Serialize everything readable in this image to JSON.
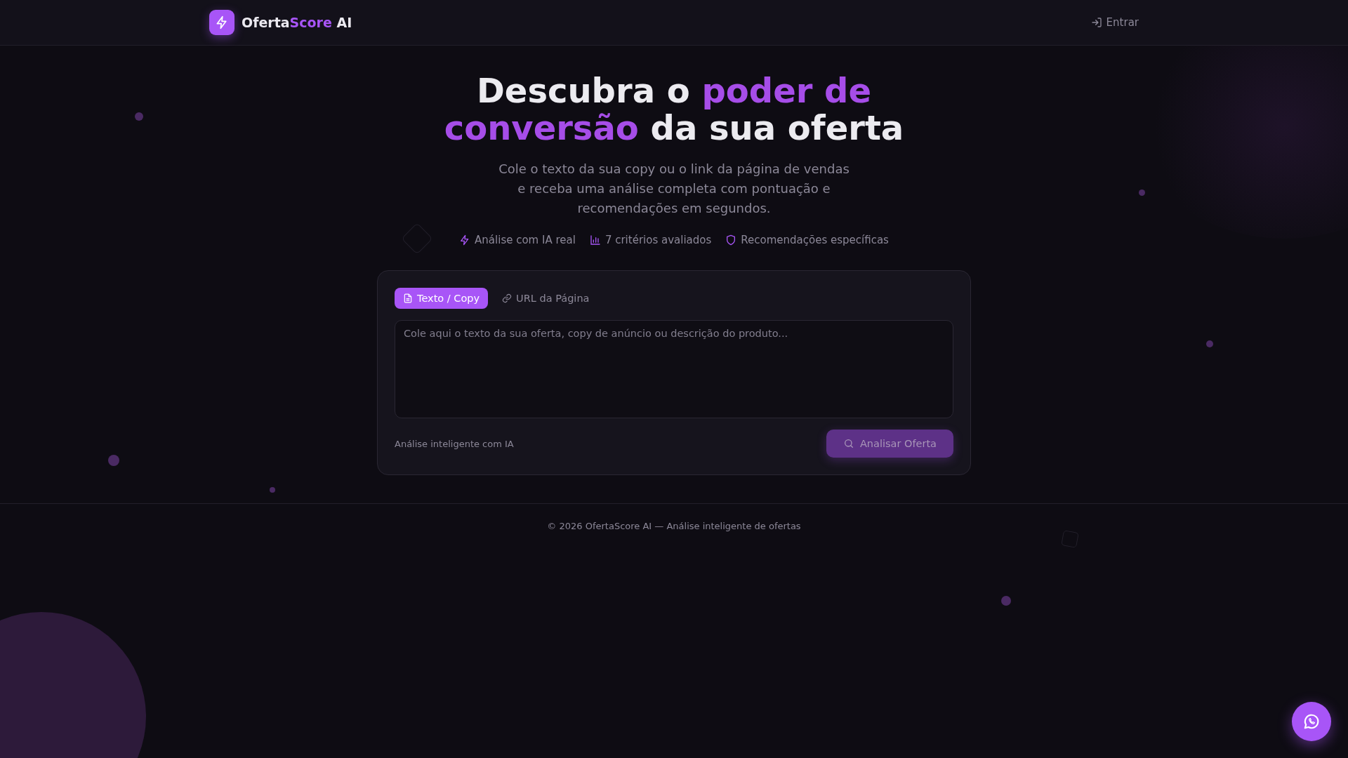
{
  "header": {
    "brand": [
      {
        "text": "Oferta",
        "highlight": false
      },
      {
        "text": "Score",
        "highlight": true
      },
      {
        "text": " AI",
        "highlight": false
      }
    ],
    "login": "Entrar"
  },
  "hero": {
    "headline": [
      {
        "text": "Descubra o ",
        "highlight": false
      },
      {
        "text": "poder de conversão",
        "highlight": true
      },
      {
        "text": " da sua oferta",
        "highlight": false
      }
    ],
    "subtitle": "Cole o texto da sua copy ou o link da página de vendas e receba uma análise completa com pontuação e recomendações em segundos.",
    "features": [
      {
        "kind": "bolt",
        "label": "Análise com IA real"
      },
      {
        "kind": "chart",
        "label": "7 critérios avaliados"
      },
      {
        "kind": "shield",
        "label": "Recomendações específicas"
      }
    ]
  },
  "form": {
    "tabs": [
      {
        "kind": "text",
        "label": "Texto / Copy",
        "selected": true
      },
      {
        "kind": "link",
        "label": "URL da Página",
        "selected": false
      }
    ],
    "input": {
      "placeholder": "Cole aqui o texto da sua oferta, copy de anúncio ou descrição do produto..."
    },
    "hint": "Análise inteligente com IA",
    "submit": {
      "label": "Analisar Oferta",
      "disabled": true
    }
  },
  "footer": "© 2026 OfertaScore AI — Análise inteligente de ofertas"
}
